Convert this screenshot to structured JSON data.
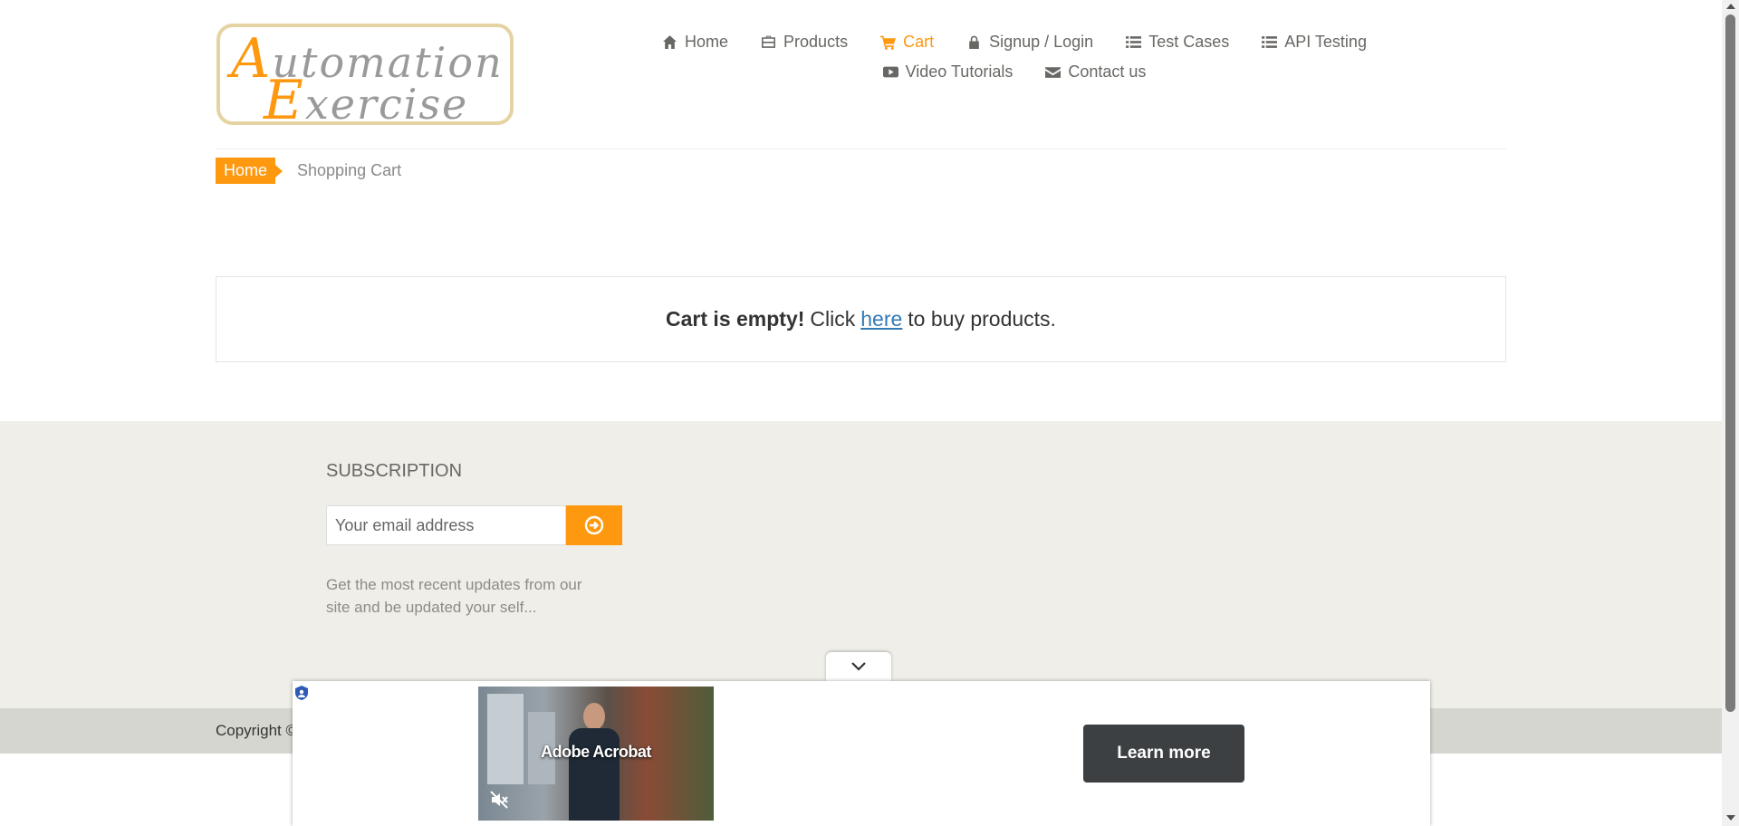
{
  "logo": {
    "line1_cap": "A",
    "line1_rest": "utomation",
    "line2_cap": "E",
    "line2_rest": "xercise"
  },
  "nav": {
    "row1": [
      {
        "label": "Home",
        "icon": "home-icon",
        "active": false
      },
      {
        "label": "Products",
        "icon": "briefcase-icon",
        "active": false
      },
      {
        "label": "Cart",
        "icon": "cart-icon",
        "active": true
      },
      {
        "label": "Signup / Login",
        "icon": "lock-icon",
        "active": false
      },
      {
        "label": "Test Cases",
        "icon": "list-icon",
        "active": false
      },
      {
        "label": "API Testing",
        "icon": "list-icon",
        "active": false
      }
    ],
    "row2": [
      {
        "label": "Video Tutorials",
        "icon": "youtube-play-icon",
        "active": false
      },
      {
        "label": "Contact us",
        "icon": "envelope-icon",
        "active": false
      }
    ]
  },
  "breadcrumb": {
    "home": "Home",
    "current": "Shopping Cart"
  },
  "cart": {
    "empty_bold": "Cart is empty!",
    "click_text": "Click",
    "link_text": "here",
    "suffix": "to buy products."
  },
  "subscription": {
    "title": "SUBSCRIPTION",
    "placeholder": "Your email address",
    "description": "Get the most recent updates from our site and be updated your self..."
  },
  "footer": {
    "copyright": "Copyright ©"
  },
  "ad": {
    "video_title": "Adobe Acrobat",
    "cta_label": "Learn more"
  },
  "colors": {
    "accent": "#fe980f",
    "link": "#337ab7",
    "footer_bg": "#efeee8",
    "footer_bottom_bg": "#d6d6d0",
    "ad_button": "#3c4043"
  }
}
